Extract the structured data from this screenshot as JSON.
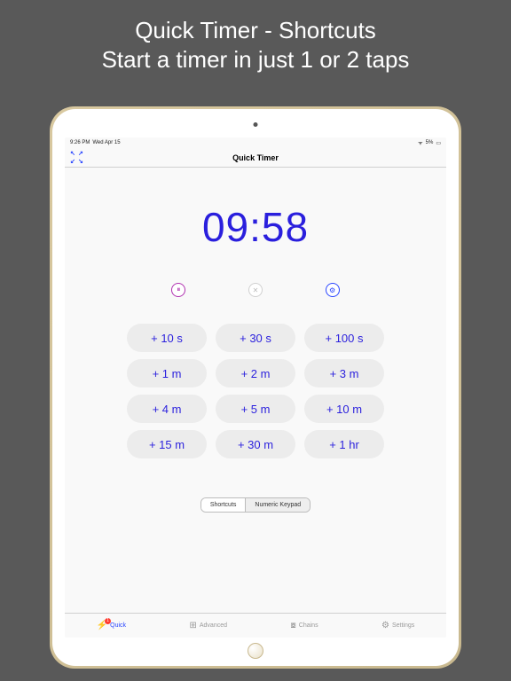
{
  "promo": {
    "line1": "Quick Timer - Shortcuts",
    "line2": "Start a timer in just 1 or 2 taps"
  },
  "status": {
    "time": "9:26 PM",
    "date": "Wed Apr 15",
    "battery": "5%"
  },
  "nav": {
    "title": "Quick Timer"
  },
  "timer": {
    "display": "09:58"
  },
  "controls": {
    "pause_glyph": "⏸",
    "cancel_glyph": "✕",
    "settings_glyph": "⚙"
  },
  "presets": [
    "+ 10 s",
    "+ 30 s",
    "+ 100 s",
    "+ 1 m",
    "+ 2 m",
    "+ 3 m",
    "+ 4 m",
    "+ 5 m",
    "+ 10 m",
    "+ 15 m",
    "+ 30 m",
    "+ 1 hr"
  ],
  "segmented": {
    "shortcuts": "Shortcuts",
    "keypad": "Numeric Keypad"
  },
  "tabs": {
    "quick": {
      "label": "Quick",
      "icon": "⚡",
      "badge": "1"
    },
    "advanced": {
      "label": "Advanced",
      "icon": "⊞"
    },
    "chains": {
      "label": "Chains",
      "icon": "⧇"
    },
    "settings": {
      "label": "Settings",
      "icon": "⚙"
    }
  }
}
